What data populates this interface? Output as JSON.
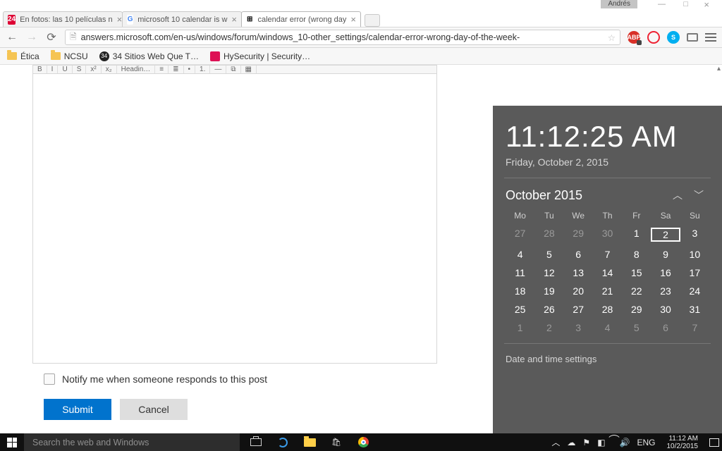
{
  "os": {
    "user": "Andrés",
    "min": "—",
    "max": "□",
    "close": "×"
  },
  "tabs": [
    {
      "favico": "24",
      "favico_bg": "#d03",
      "favico_fg": "#fff",
      "title": "En fotos: las 10 películas n",
      "active": false
    },
    {
      "favico": "G",
      "favico_bg": "#fff",
      "favico_fg": "#4285f4",
      "title": "microsoft 10 calendar is w",
      "active": false
    },
    {
      "favico": "⊞",
      "favico_bg": "#fff",
      "favico_fg": "#000",
      "title": "calendar error (wrong day",
      "active": true
    }
  ],
  "nav": {
    "back": "←",
    "fwd": "→",
    "reload": "⟳",
    "url": "answers.microsoft.com/en-us/windows/forum/windows_10-other_settings/calendar-error-wrong-day-of-the-week-",
    "star": "☆"
  },
  "ext": {
    "abp": "ABP",
    "skype": "S"
  },
  "bookmarks": [
    {
      "kind": "fold",
      "label": "Ética"
    },
    {
      "kind": "fold",
      "label": "NCSU"
    },
    {
      "kind": "dot",
      "label": "34 Sitios Web Que T…"
    },
    {
      "kind": "hs",
      "label": "HySecurity | Security…"
    }
  ],
  "editor_tb": [
    "B",
    "I",
    "U",
    "S",
    "x²",
    "x₂",
    "Headin…",
    "≡",
    "≣",
    "•",
    "1.",
    "—",
    "⧉",
    "▦"
  ],
  "notify_label": "Notify me when someone responds to this post",
  "buttons": {
    "submit": "Submit",
    "cancel": "Cancel"
  },
  "clock": {
    "time": "11:12:25 AM",
    "date": "Friday, October 2, 2015",
    "month_year": "October 2015",
    "dow": [
      "Mo",
      "Tu",
      "We",
      "Th",
      "Fr",
      "Sa",
      "Su"
    ],
    "cells": [
      {
        "n": "27",
        "dim": true
      },
      {
        "n": "28",
        "dim": true
      },
      {
        "n": "29",
        "dim": true
      },
      {
        "n": "30",
        "dim": true
      },
      {
        "n": "1"
      },
      {
        "n": "2",
        "today": true
      },
      {
        "n": "3"
      },
      {
        "n": "4"
      },
      {
        "n": "5"
      },
      {
        "n": "6"
      },
      {
        "n": "7"
      },
      {
        "n": "8"
      },
      {
        "n": "9"
      },
      {
        "n": "10"
      },
      {
        "n": "11"
      },
      {
        "n": "12"
      },
      {
        "n": "13"
      },
      {
        "n": "14"
      },
      {
        "n": "15"
      },
      {
        "n": "16"
      },
      {
        "n": "17"
      },
      {
        "n": "18"
      },
      {
        "n": "19"
      },
      {
        "n": "20"
      },
      {
        "n": "21"
      },
      {
        "n": "22"
      },
      {
        "n": "23"
      },
      {
        "n": "24"
      },
      {
        "n": "25"
      },
      {
        "n": "26"
      },
      {
        "n": "27"
      },
      {
        "n": "28"
      },
      {
        "n": "29"
      },
      {
        "n": "30"
      },
      {
        "n": "31"
      },
      {
        "n": "1",
        "dim": true
      },
      {
        "n": "2",
        "dim": true
      },
      {
        "n": "3",
        "dim": true
      },
      {
        "n": "4",
        "dim": true
      },
      {
        "n": "5",
        "dim": true
      },
      {
        "n": "6",
        "dim": true
      },
      {
        "n": "7",
        "dim": true
      }
    ],
    "settings": "Date and time settings"
  },
  "taskbar": {
    "search_placeholder": "Search the web and Windows",
    "lang": "ENG",
    "time": "11:12 AM",
    "date": "10/2/2015",
    "chev": "︿"
  }
}
